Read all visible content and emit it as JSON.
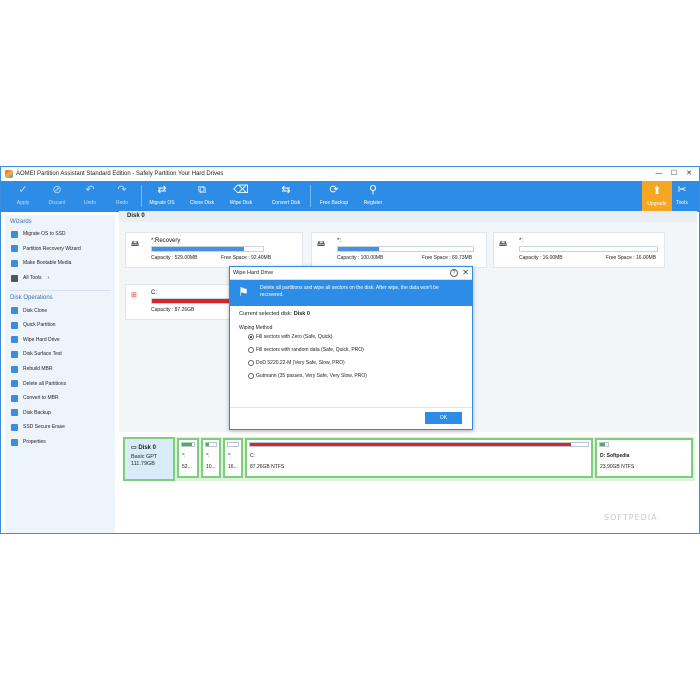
{
  "window": {
    "title": "AOMEI Partition Assistant Standard Edition - Safely Partition Your Hard Drives",
    "controls": {
      "minimize": "—",
      "maximize": "☐",
      "close": "✕"
    }
  },
  "toolbar": {
    "apply": "Apply",
    "discard": "Discard",
    "undo": "Undo",
    "redo": "Redo",
    "migrate_os": "Migrate OS",
    "clone_disk": "Clone Disk",
    "wipe_disk": "Wipe Disk",
    "convert_disk": "Convert Disk",
    "free_backup": "Free Backup",
    "register": "Register",
    "upgrade": "Upgrade",
    "tools": "Tools"
  },
  "sidebar": {
    "wizards_heading": "Wizards",
    "wizards": [
      {
        "label": "Migrate OS to SSD"
      },
      {
        "label": "Partition Recovery Wizard"
      },
      {
        "label": "Make Bootable Media"
      },
      {
        "label": "All Tools"
      }
    ],
    "disk_ops_heading": "Disk Operations",
    "disk_ops": [
      {
        "label": "Disk Clone"
      },
      {
        "label": "Quick Partition"
      },
      {
        "label": "Wipe Hard Drive"
      },
      {
        "label": "Disk Surface Test"
      },
      {
        "label": "Rebuild MBR"
      },
      {
        "label": "Delete all Partitions"
      },
      {
        "label": "Convert to MBR"
      },
      {
        "label": "Disk Backup"
      },
      {
        "label": "SSD Secure Erase"
      },
      {
        "label": "Properties"
      }
    ]
  },
  "main": {
    "disk_header": "Disk 0",
    "partitions": [
      {
        "name": "*:Recovery",
        "capacity": "Capacity : 529.00MB",
        "free": "Free Space : 92.40MB",
        "used_fraction": 0.83
      },
      {
        "name": "*:",
        "capacity": "Capacity : 100.00MB",
        "free": "Free Space : 69.73MB",
        "used_fraction": 0.3
      },
      {
        "name": "*:",
        "capacity": "Capacity : 16.00MB",
        "free": "Free Space : 16.00MB",
        "used_fraction": 0.0
      },
      {
        "name": "C:",
        "capacity": "Capacity : 87.26GB",
        "free": "",
        "used_fraction": 0.95
      }
    ],
    "disk_map": {
      "disk_label": "Disk 0",
      "disk_type": "Basic GPT",
      "disk_size": "111.79GB",
      "blocks": [
        {
          "name": "*:",
          "size": "52..."
        },
        {
          "name": "*:",
          "size": "10..."
        },
        {
          "name": "*:",
          "size": "16..."
        },
        {
          "name": "C:",
          "size": "87.26GB NTFS"
        },
        {
          "name": "D: Softpedia",
          "size": "23.90GB NTFS"
        }
      ]
    }
  },
  "dialog": {
    "title": "Wipe Hard Drive",
    "help": "?",
    "close": "✕",
    "banner_text": "Delete all partitions and wipe all sectors on the disk. After wipe, the data won't be recovered.",
    "current_label": "Current selected disk: ",
    "current_disk": "Disk 0",
    "method_label": "Wiping Method",
    "methods": [
      {
        "label": "Fill sectors with Zero (Safe, Quick)",
        "selected": true
      },
      {
        "label": "Fill sectors with random data (Safe, Quick, PRO)",
        "selected": false
      },
      {
        "label": "DoD 5220.22-M (Very Safe, Slow, PRO)",
        "selected": false
      },
      {
        "label": "Gutmann (35 passes, Very Safe, Very Slow, PRO)",
        "selected": false
      }
    ],
    "ok": "OK"
  },
  "watermark": "SOFTPEDIA",
  "colors": {
    "accent": "#2d8de6",
    "upgrade": "#f5a623",
    "used_bar": "#4a90e2",
    "c_used_bar": "#d9262a",
    "disk_map_border": "#7dcf7d"
  }
}
